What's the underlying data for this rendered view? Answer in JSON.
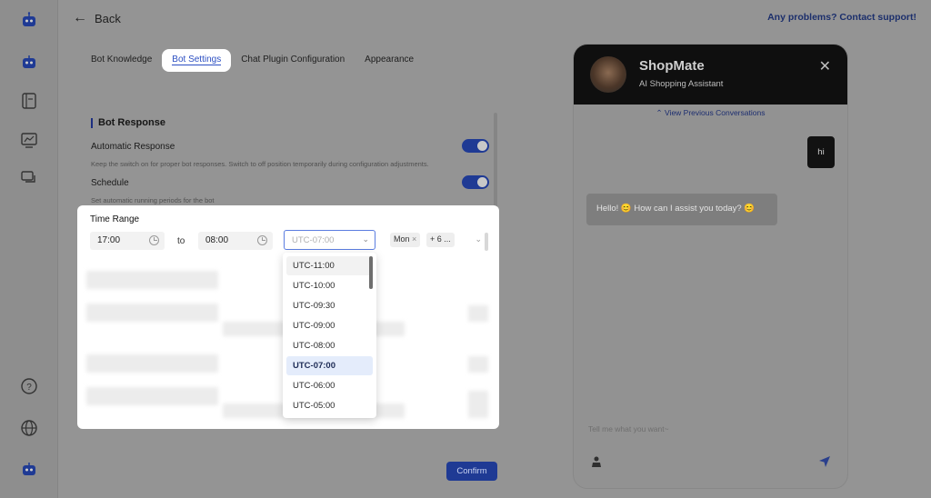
{
  "colors": {
    "accent": "#2b4ec2",
    "toggle_on": "#1f3a94",
    "selected_option_bg": "#e4ecfb",
    "chat_header": "#0f0f0f"
  },
  "sidebar": {
    "icons": [
      "robot-logo-icon",
      "bot-icon",
      "document-icon",
      "analytics-icon",
      "chat-icon",
      "help-icon",
      "globe-icon",
      "robot-icon"
    ]
  },
  "header": {
    "back_label": "Back",
    "help_link": "Any problems? Contact support!"
  },
  "tabs": [
    {
      "label": "Bot Knowledge",
      "active": false
    },
    {
      "label": "Bot Settings",
      "active": true
    },
    {
      "label": "Chat Plugin Configuration",
      "active": false
    },
    {
      "label": "Appearance",
      "active": false
    }
  ],
  "bot_response": {
    "title": "Bot Response",
    "automatic": {
      "label": "Automatic Response",
      "desc": "Keep the switch on for proper bot responses. Switch to off position temporarily during configuration adjustments.",
      "on": true
    },
    "schedule": {
      "label": "Schedule",
      "desc": "Set automatic running periods for the bot",
      "on": true
    }
  },
  "time_range": {
    "label": "Time Range",
    "start": "17:00",
    "to_label": "to",
    "end": "08:00",
    "timezone_placeholder": "UTC-07:00",
    "days": {
      "chip_1": "Mon",
      "chip_2": "+ 6 ..."
    }
  },
  "timezone_options": [
    "UTC-11:00",
    "UTC-10:00",
    "UTC-09:30",
    "UTC-09:00",
    "UTC-08:00",
    "UTC-07:00",
    "UTC-06:00",
    "UTC-05:00"
  ],
  "timezone_selected": "UTC-07:00",
  "confirm_label": "Confirm",
  "chat": {
    "bot_name": "ShopMate",
    "bot_subtitle": "AI Shopping Assistant",
    "view_previous": "View Previous Conversations",
    "user_message": "hi",
    "bot_message": "Hello! 😊 How can I assist you today? 😊",
    "input_placeholder": "Tell me what you want~"
  }
}
